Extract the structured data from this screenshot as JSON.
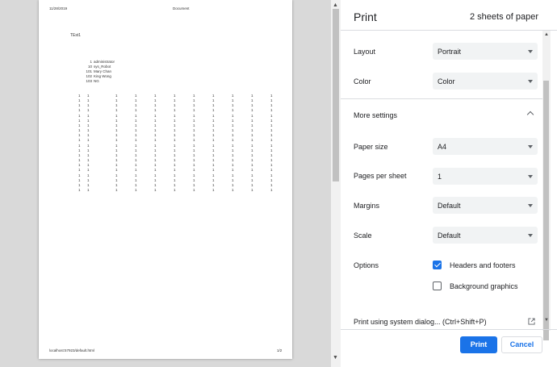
{
  "preview": {
    "header_date": "11/28/2019",
    "header_title": "Document",
    "heading": "TEst1",
    "users": [
      {
        "id": "1",
        "name": "administrator"
      },
      {
        "id": "10",
        "name": "sys_Robot"
      },
      {
        "id": "101",
        "name": "Mary Chan"
      },
      {
        "id": "102",
        "name": "King Wong"
      },
      {
        "id": "103",
        "name": "NG"
      }
    ],
    "grid_cell_value": "1",
    "grid_column_count": 11,
    "grid_row_count": 20,
    "footer_url": "localhost:57923/default.html",
    "footer_page": "1/2"
  },
  "panel": {
    "title": "Print",
    "sheet_count": "2 sheets of paper",
    "layout": {
      "label": "Layout",
      "value": "Portrait"
    },
    "color": {
      "label": "Color",
      "value": "Color"
    },
    "more_settings": "More settings",
    "paper_size": {
      "label": "Paper size",
      "value": "A4"
    },
    "pages_per_sheet": {
      "label": "Pages per sheet",
      "value": "1"
    },
    "margins": {
      "label": "Margins",
      "value": "Default"
    },
    "scale": {
      "label": "Scale",
      "value": "Default"
    },
    "options": {
      "label": "Options",
      "headers_footers": {
        "label": "Headers and footers",
        "checked": true
      },
      "background_graphics": {
        "label": "Background graphics",
        "checked": false
      }
    },
    "system_dialog": "Print using system dialog... (Ctrl+Shift+P)",
    "print_button": "Print",
    "cancel_button": "Cancel"
  },
  "colors": {
    "accent": "#1a73e8",
    "preview_bg": "#d9d9d9",
    "select_bg": "#f1f3f4"
  },
  "icons": [
    "scroll-up-arrow",
    "scroll-down-arrow",
    "chevron-down-icon",
    "chevron-up-icon",
    "checkbox-icon",
    "open-in-new-icon"
  ]
}
